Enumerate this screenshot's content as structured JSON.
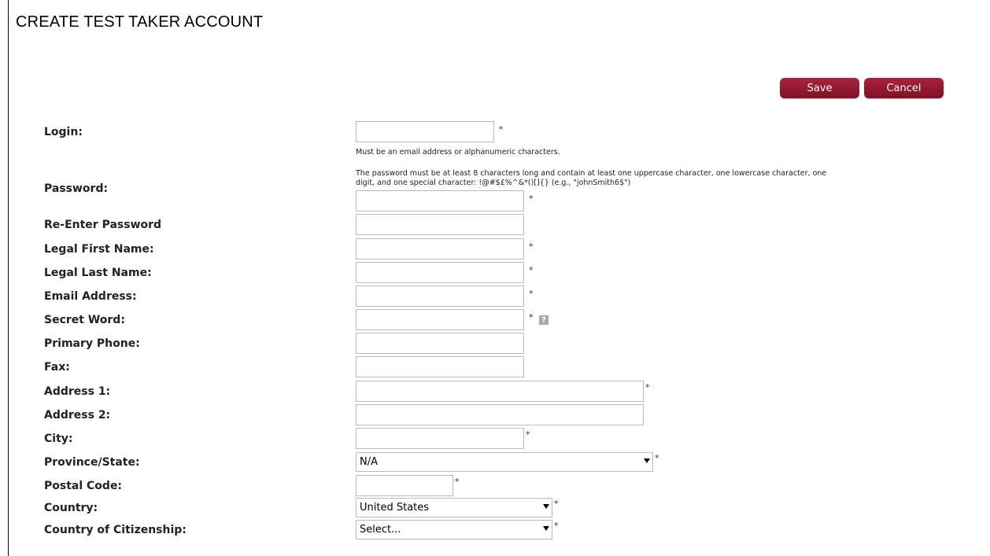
{
  "page": {
    "title": "CREATE TEST TAKER ACCOUNT"
  },
  "toolbar": {
    "save_label": "Save",
    "cancel_label": "Cancel"
  },
  "form": {
    "login": {
      "label": "Login:",
      "value": "",
      "required_mark": "*",
      "hint": "Must be an email address or alphanumeric characters."
    },
    "password": {
      "label": "Password:",
      "value": "",
      "required_mark": "*",
      "hint_line1": "The password must be at least 8 characters long and contain at least one uppercase character, one lowercase character, one",
      "hint_line2": "digit, and one special character: !@#$£%^&*()[]{} (e.g., \"johnSmith6$\")"
    },
    "reenter_password": {
      "label": "Re-Enter Password",
      "value": ""
    },
    "first_name": {
      "label": "Legal First Name:",
      "value": "",
      "required_mark": "*"
    },
    "last_name": {
      "label": "Legal Last Name:",
      "value": "",
      "required_mark": "*"
    },
    "email": {
      "label": "Email Address:",
      "value": "",
      "required_mark": "*"
    },
    "secret_word": {
      "label": "Secret Word:",
      "value": "",
      "required_mark": "*",
      "help_icon": "question-icon"
    },
    "primary_phone": {
      "label": "Primary Phone:",
      "value": ""
    },
    "fax": {
      "label": "Fax:",
      "value": ""
    },
    "address1": {
      "label": "Address 1:",
      "value": "",
      "required_mark": "*"
    },
    "address2": {
      "label": "Address 2:",
      "value": ""
    },
    "city": {
      "label": "City:",
      "value": "",
      "required_mark": "*"
    },
    "province_state": {
      "label": "Province/State:",
      "value": "N/A",
      "required_mark": "*"
    },
    "postal_code": {
      "label": "Postal Code:",
      "value": "",
      "required_mark": "*"
    },
    "country": {
      "label": "Country:",
      "value": "United States",
      "required_mark": "*"
    },
    "citizenship": {
      "label": "Country of Citizenship:",
      "value": "Select...",
      "required_mark": "*"
    }
  },
  "colors": {
    "button_bg": "#8b1a31",
    "border": "#b9b9b9"
  }
}
